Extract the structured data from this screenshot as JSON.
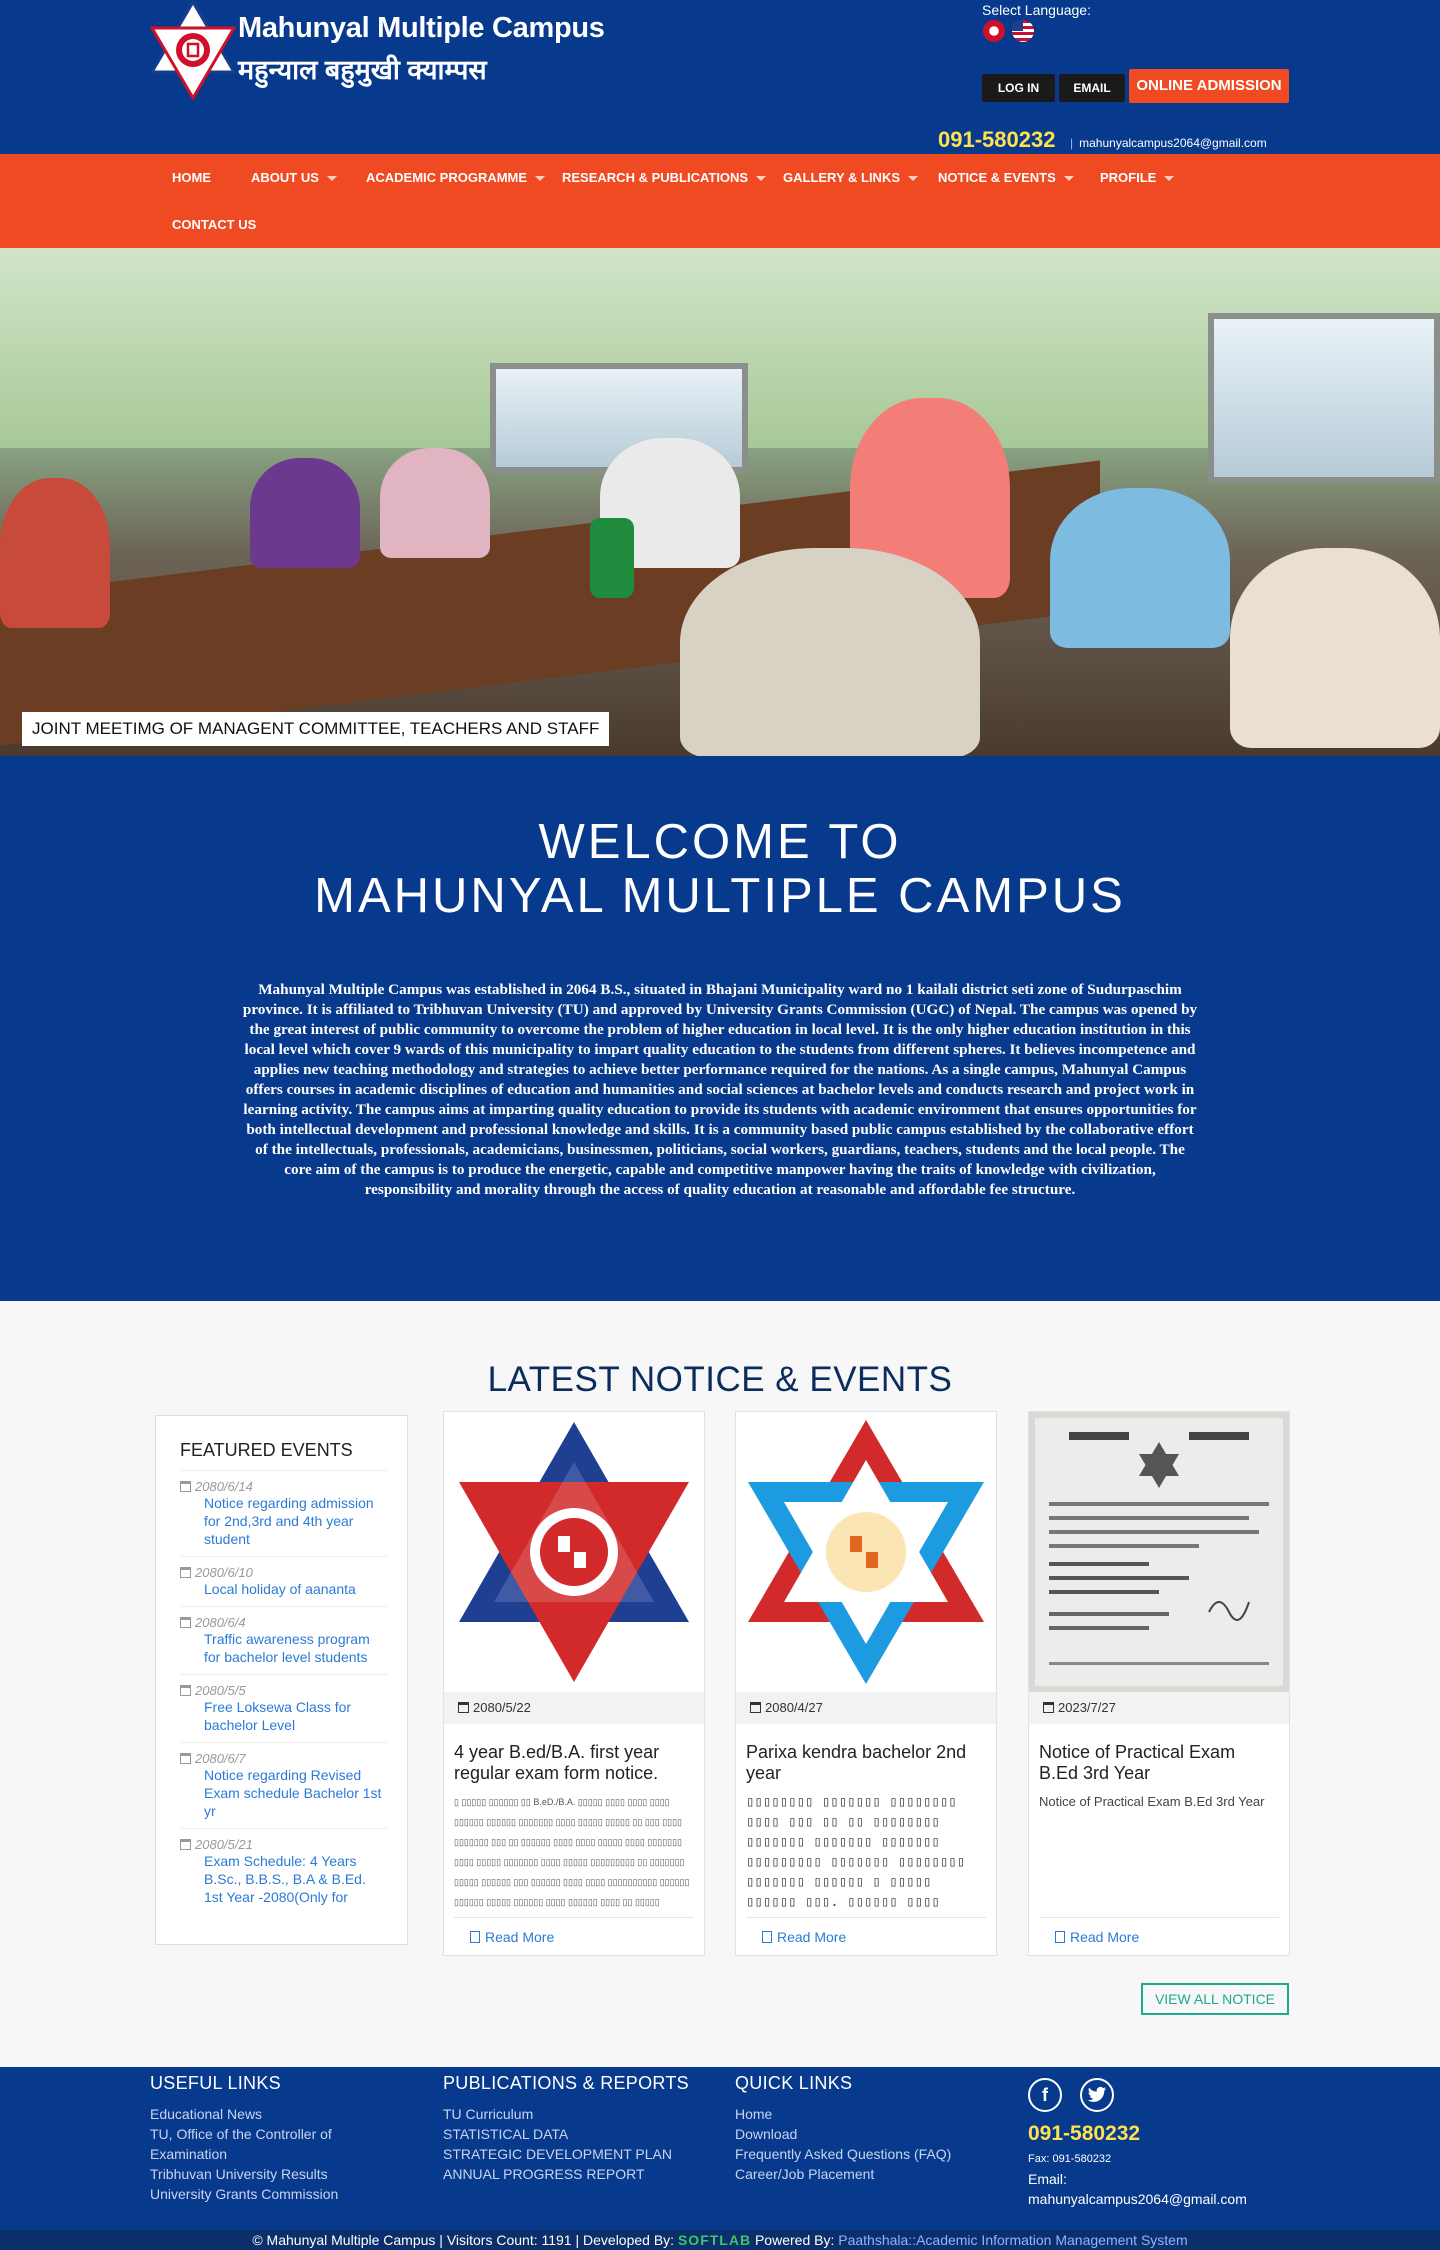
{
  "header": {
    "logo_en": "Mahunyal Multiple Campus",
    "logo_np": "महुन्याल बहुमुखी क्याम्पस",
    "select_language": "Select Language:",
    "login": "LOG IN",
    "email_button": "EMAIL",
    "online_admission": "ONLINE ADMISSION",
    "phone": "091-580232",
    "email": "mahunyalcampus2064@gmail.com"
  },
  "nav": {
    "items": [
      {
        "label": "HOME"
      },
      {
        "label": "ABOUT US"
      },
      {
        "label": "ACADEMIC PROGRAMME"
      },
      {
        "label": "RESEARCH & PUBLICATIONS"
      },
      {
        "label": "GALLERY & LINKS"
      },
      {
        "label": "NOTICE & EVENTS"
      },
      {
        "label": "PROFILE"
      },
      {
        "label": "CONTACT US"
      }
    ]
  },
  "hero": {
    "caption": "JOINT MEETIMG OF MANAGENT COMMITTEE, TEACHERS AND STAFF"
  },
  "welcome": {
    "title_line1": "WELCOME TO",
    "title_line2": "MAHUNYAL MULTIPLE CAMPUS",
    "body": "Mahunyal Multiple Campus was established in 2064 B.S., situated in Bhajani Municipality ward no 1 kailali district seti zone of Sudurpaschim province. It is affiliated to Tribhuvan University (TU) and approved by University Grants Commission (UGC) of Nepal. The campus was opened by the great interest of public community to overcome the problem of higher education in local level. It is the only higher education institution in this local level which cover 9 wards of this municipality to impart quality education to the students from different spheres. It believes incompetence and applies new teaching methodology and strategies to achieve better performance required for the nations. As a single campus, Mahunyal Campus offers courses in academic disciplines of education and humanities and social sciences at bachelor levels and conducts research and project work in learning activity. The campus aims at imparting quality education to provide its students with academic environment that ensures opportunities for both intellectual development and professional knowledge and skills. It is a community based public campus established by the collaborative effort of the intellectuals, professionals, academicians, businessmen, politicians, social workers, guardians, teachers, students and the local people. The core aim of the campus is to produce the energetic, capable and competitive manpower having the traits of knowledge with civilization, responsibility and morality through the access of quality education at reasonable and affordable fee structure."
  },
  "notices": {
    "title": "LATEST NOTICE & EVENTS",
    "featured_title": "FEATURED EVENTS",
    "featured": [
      {
        "date": "2080/6/14",
        "title": "Notice regarding admission for 2nd,3rd and 4th year student"
      },
      {
        "date": "2080/6/10",
        "title": "Local holiday of aananta"
      },
      {
        "date": "2080/6/4",
        "title": "Traffic awareness program for bachelor level students"
      },
      {
        "date": "2080/5/5",
        "title": "Free Loksewa Class for bachelor Level"
      },
      {
        "date": "2080/6/7",
        "title": "Notice regarding Revised Exam schedule Bachelor 1st yr"
      },
      {
        "date": "2080/5/21",
        "title": "Exam Schedule: 4 Years B.Sc., B.B.S., B.A & B.Ed. 1st Year -2080(Only for"
      }
    ],
    "cards": [
      {
        "date": "2080/5/22",
        "title": "4 year B.ed/B.A. first year regular exam form notice.",
        "excerpt": "▯ ▯▯▯▯▯ ▯▯▯▯▯▯ ▯▯ B.eD./B.A. ▯▯▯▯▯ ▯▯▯▯ ▯▯▯▯ ▯▯▯▯ ▯▯▯▯▯▯ ▯▯▯▯▯▯ ▯▯▯▯▯▯▯ ▯▯▯▯ ▯▯▯▯▯ ▯▯▯▯▯ ▯▯ ▯▯▯ ▯▯▯▯ ▯▯▯▯▯▯▯ ▯▯▯ ▯▯ ▯▯▯▯▯▯ ▯▯▯▯ ▯▯▯▯ ▯▯▯▯▯ ▯▯▯▯ ▯▯▯▯▯▯▯ ▯▯▯▯ ▯▯▯▯▯ ▯▯▯▯▯▯▯ ▯▯▯▯ ▯▯▯▯▯ ▯▯▯▯▯▯▯▯▯ ▯▯ ▯▯▯▯▯▯▯ ▯▯▯▯▯ ▯▯▯▯▯▯ ▯▯▯ ▯▯▯▯▯▯ ▯▯▯▯ ▯▯▯▯ ▯▯▯▯▯▯▯▯▯▯ ▯▯▯▯▯▯ ▯▯▯▯▯▯ ▯▯▯▯▯ ▯▯▯▯▯▯ ▯▯▯▯ ▯▯▯▯▯▯ ▯▯▯▯ ▯▯ ▯▯▯▯▯",
        "read_more": "Read More"
      },
      {
        "date": "2080/4/27",
        "title": "Parixa kendra bachelor 2nd year",
        "excerpt": "▯▯▯▯▯▯▯▯ ▯▯▯▯▯▯▯ ▯▯▯▯▯▯▯▯ ▯▯▯▯ ▯▯▯ ▯▯ ▯▯ ▯▯▯▯▯▯▯▯ ▯▯▯▯▯▯▯ ▯▯▯▯▯▯▯ ▯▯▯▯▯▯▯ ▯▯▯▯▯▯▯▯▯ ▯▯▯▯▯▯▯ ▯▯▯▯▯▯▯▯ ▯▯▯▯▯▯▯ ▯▯▯▯▯▯ ▯ ▯▯▯▯▯ ▯▯▯▯▯▯ ▯▯▯. ▯▯▯▯▯▯ ▯▯▯▯ ▯▯▯▯▯",
        "read_more": "Read More"
      },
      {
        "date": "2023/7/27",
        "title": "Notice of Practical Exam B.Ed 3rd Year",
        "excerpt": "Notice of Practical Exam B.Ed 3rd Year",
        "read_more": "Read More"
      }
    ],
    "view_all": "VIEW ALL NOTICE"
  },
  "footer": {
    "useful_links": {
      "title": "USEFUL LINKS",
      "items": [
        "Educational News",
        "TU, Office of the Controller of Examination",
        "Tribhuvan University Results",
        "University Grants Commission"
      ]
    },
    "publications": {
      "title": "PUBLICATIONS & REPORTS",
      "items": [
        "TU Curriculum",
        "STATISTICAL DATA",
        "STRATEGIC DEVELOPMENT PLAN",
        "ANNUAL PROGRESS REPORT"
      ]
    },
    "quick_links": {
      "title": "QUICK LINKS",
      "items": [
        "Home",
        "Download",
        "Frequently Asked Questions (FAQ)",
        "Career/Job Placement"
      ]
    },
    "contact": {
      "phone": "091-580232",
      "fax": "Fax: 091-580232",
      "email_label": "Email:",
      "email": "mahunyalcampus2064@gmail.com"
    },
    "bottom": {
      "prefix": "© Mahunyal Multiple Campus | Visitors Count: 1191 | Developed By:",
      "developer": "SOFTLAB",
      "powered_label": "Powered By:",
      "powered_by": "Paathshala::Academic Information Management System"
    }
  },
  "icons": {
    "facebook": "facebook-icon",
    "twitter": "twitter-icon",
    "calendar": "calendar-icon",
    "document": "document-icon"
  },
  "colors": {
    "primary_blue": "#073a8d",
    "accent_orange": "#f04a23",
    "phone_yellow": "#ffe14d",
    "link_blue": "#2b7bd6",
    "teal": "#1fa98c"
  }
}
